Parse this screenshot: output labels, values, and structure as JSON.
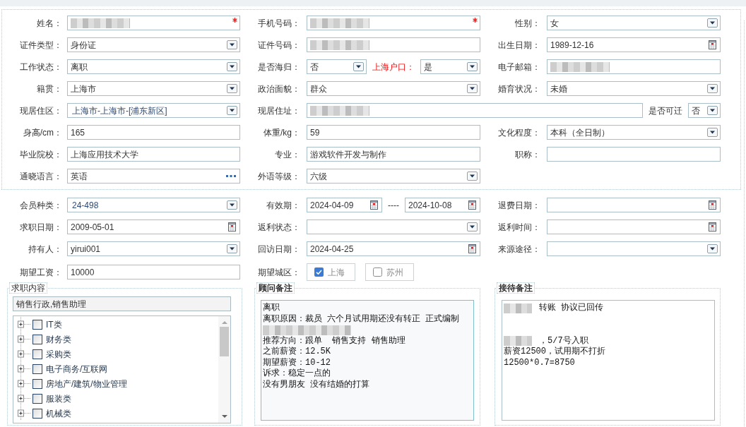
{
  "profile": {
    "rows": [
      {
        "columns": [
          {
            "fields": [
              {
                "label": "姓名：",
                "kind": "text",
                "redacted": true,
                "required": true
              }
            ]
          },
          {
            "fields": [
              {
                "label": "手机号码：",
                "kind": "text",
                "redacted": true,
                "required": true
              }
            ]
          },
          {
            "fields": [
              {
                "label": "性别：",
                "kind": "select",
                "value": "女"
              }
            ]
          }
        ]
      },
      {
        "columns": [
          {
            "fields": [
              {
                "label": "证件类型：",
                "kind": "select",
                "value": "身份证"
              }
            ]
          },
          {
            "fields": [
              {
                "label": "证件号码：",
                "kind": "text",
                "redacted": true
              }
            ]
          },
          {
            "fields": [
              {
                "label": "出生日期：",
                "kind": "date",
                "value": "1989-12-16"
              }
            ]
          }
        ]
      },
      {
        "columns": [
          {
            "fields": [
              {
                "label": "工作状态：",
                "kind": "select",
                "value": "离职"
              }
            ]
          },
          {
            "fields": [
              {
                "label": "是否海归：",
                "kind": "select",
                "value": "否"
              },
              {
                "label": "上海户口：",
                "kind": "select",
                "value": "是",
                "highlighted": true
              }
            ]
          },
          {
            "fields": [
              {
                "label": "电子邮箱：",
                "kind": "text",
                "redacted": true
              }
            ]
          }
        ]
      },
      {
        "columns": [
          {
            "fields": [
              {
                "label": "籍贯：",
                "kind": "select",
                "value": "上海市"
              }
            ]
          },
          {
            "fields": [
              {
                "label": "政治面貌：",
                "kind": "select",
                "value": "群众"
              }
            ]
          },
          {
            "fields": [
              {
                "label": "婚育状况：",
                "kind": "select",
                "value": "未婚"
              }
            ]
          }
        ]
      },
      {
        "columns": [
          {
            "fields": [
              {
                "label": "现居住区：",
                "kind": "combo",
                "value": "上海市-上海市-[浦东新区]"
              }
            ]
          },
          {
            "fields": [
              {
                "label": "现居住址：",
                "kind": "text",
                "redacted": true
              },
              {
                "label": "是否可迁",
                "kind": "select",
                "value": "否"
              }
            ]
          }
        ]
      },
      {
        "columns": [
          {
            "fields": [
              {
                "label": "身高/cm：",
                "kind": "text",
                "value": "165"
              }
            ]
          },
          {
            "fields": [
              {
                "label": "体重/kg：",
                "kind": "text",
                "value": "59"
              }
            ]
          },
          {
            "fields": [
              {
                "label": "文化程度：",
                "kind": "select",
                "value": "本科（全日制）"
              }
            ]
          }
        ]
      },
      {
        "columns": [
          {
            "fields": [
              {
                "label": "毕业院校：",
                "kind": "text",
                "value": "上海应用技术大学"
              }
            ]
          },
          {
            "fields": [
              {
                "label": "专业：",
                "kind": "text",
                "value": "游戏软件开发与制作"
              }
            ]
          },
          {
            "fields": [
              {
                "label": "职称：",
                "kind": "text"
              }
            ]
          }
        ]
      },
      {
        "columns": [
          {
            "fields": [
              {
                "label": "通晓语言：",
                "kind": "picker",
                "value": "英语"
              }
            ]
          },
          {
            "fields": [
              {
                "label": "外语等级：",
                "kind": "select",
                "value": "六级"
              }
            ]
          }
        ]
      }
    ]
  },
  "membership": {
    "rows": [
      {
        "columns": [
          {
            "fields": [
              {
                "label": "会员种类：",
                "kind": "combo",
                "value": "24-498"
              }
            ]
          },
          {
            "fields": [
              {
                "label": "有效期：",
                "kind": "date_range",
                "start": "2024-04-09",
                "separator": "----",
                "end": "2024-10-08"
              }
            ]
          },
          {
            "fields": [
              {
                "label": "退费日期：",
                "kind": "date"
              }
            ]
          }
        ]
      },
      {
        "columns": [
          {
            "fields": [
              {
                "label": "求职日期：",
                "kind": "date",
                "value": "2009-05-01"
              }
            ]
          },
          {
            "fields": [
              {
                "label": "返利状态：",
                "kind": "select"
              }
            ]
          },
          {
            "fields": [
              {
                "label": "返利时间：",
                "kind": "date"
              }
            ]
          }
        ]
      },
      {
        "columns": [
          {
            "fields": [
              {
                "label": "持有人：",
                "kind": "select",
                "value": "yirui001"
              }
            ]
          },
          {
            "fields": [
              {
                "label": "回访日期：",
                "kind": "date",
                "value": "2024-04-25"
              }
            ]
          },
          {
            "fields": [
              {
                "label": "来源途径：",
                "kind": "select"
              }
            ]
          }
        ]
      },
      {
        "columns": [
          {
            "fields": [
              {
                "label": "期望工资：",
                "kind": "text",
                "value": "10000"
              }
            ]
          },
          {
            "fields": [
              {
                "label": "期望城区：",
                "kind": "checks",
                "options": [
                  {
                    "label": "上海",
                    "checked": true
                  },
                  {
                    "label": "苏州",
                    "checked": false
                  }
                ]
              }
            ]
          }
        ]
      }
    ]
  },
  "panels": [
    {
      "kind": "tree",
      "title": "求职内容",
      "value": "销售行政,销售助理",
      "items": [
        {
          "label": "IT类",
          "checked": false,
          "expanded": false
        },
        {
          "label": "财务类",
          "checked": false,
          "expanded": false
        },
        {
          "label": "采购类",
          "checked": false,
          "expanded": false
        },
        {
          "label": "电子商务/互联网",
          "checked": false,
          "expanded": false
        },
        {
          "label": "房地产/建筑/物业管理",
          "checked": false,
          "expanded": false
        },
        {
          "label": "服装类",
          "checked": false,
          "expanded": false
        },
        {
          "label": "机械类",
          "checked": false,
          "expanded": false
        }
      ]
    },
    {
      "kind": "notes",
      "title": "顾问备注",
      "focused": true,
      "lines": [
        {
          "kind": "text",
          "text": "离职"
        },
        {
          "kind": "text",
          "text": "离职原因：裁员 六个月试用期还没有转正 正式编制"
        },
        {
          "kind": "redacted"
        },
        {
          "kind": "text",
          "text": "推荐方向：跟单  销售支持 销售助理"
        },
        {
          "kind": "text",
          "text": "之前薪资：12.5K"
        },
        {
          "kind": "text",
          "text": "期望薪资：10-12"
        },
        {
          "kind": "text",
          "text": "诉求：稳定一点的"
        },
        {
          "kind": "text",
          "text": "没有男朋友 没有结婚的打算"
        }
      ]
    },
    {
      "kind": "notes",
      "title": "接待备注",
      "focused": false,
      "lines": [
        {
          "kind": "redacted_prefix",
          "text": "转账 协议已回传"
        },
        {
          "kind": "blank"
        },
        {
          "kind": "blank"
        },
        {
          "kind": "redacted_prefix",
          "text": "，5/7号入职"
        },
        {
          "kind": "text",
          "text": "薪资12500，试用期不打折"
        },
        {
          "kind": "text",
          "text": "12500*0.7=8750"
        }
      ]
    }
  ]
}
